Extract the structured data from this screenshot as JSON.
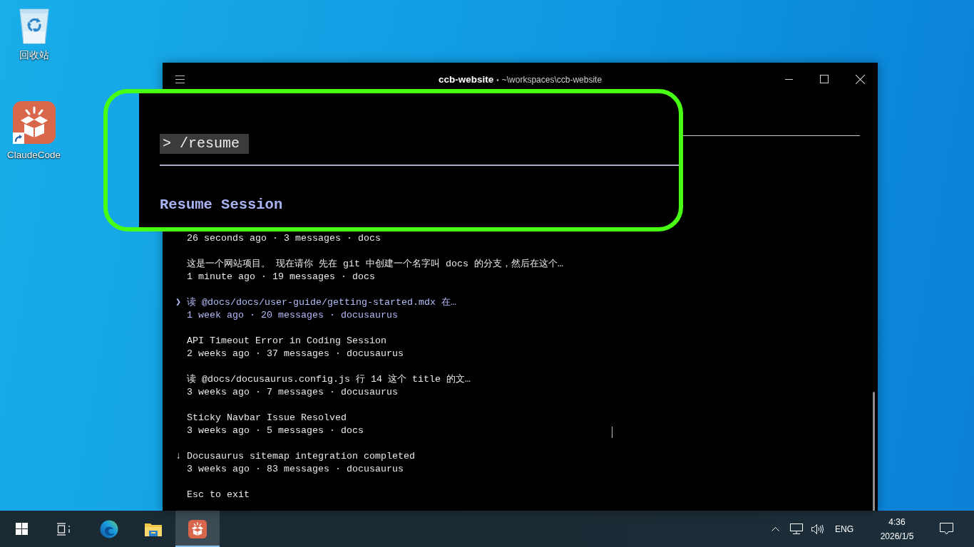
{
  "desktop_icons": [
    {
      "kind": "recycle-bin",
      "label": "回收站"
    },
    {
      "kind": "app-shortcut",
      "label": "ClaudeCode"
    }
  ],
  "window": {
    "title": "ccb-website",
    "separator": "•",
    "path": "~\\workspaces\\ccb-website"
  },
  "highlight": {
    "prompt": "> /resume",
    "heading": "Resume Session"
  },
  "sessions": [
    {
      "meta": "26 seconds ago · 3 messages · docs",
      "selected": false
    },
    {
      "title": "这是一个网站项目。 现在请你 先在 git 中创建一个名字叫 docs 的分支，然后在这个…",
      "meta": "1 minute ago · 19 messages · docs",
      "selected": false
    },
    {
      "marker": "❯",
      "title": "读 @docs/docs/user-guide/getting-started.mdx 在…",
      "meta": "1 week ago · 20 messages · docusaurus",
      "selected": true
    },
    {
      "title": "API Timeout Error in Coding Session",
      "meta": "2 weeks ago · 37 messages · docusaurus",
      "selected": false
    },
    {
      "title": "读 @docs/docusaurus.config.js 行 14 这个 title 的文…",
      "meta": "3 weeks ago · 7 messages · docusaurus",
      "selected": false
    },
    {
      "title": "Sticky Navbar Issue Resolved",
      "meta": "3 weeks ago · 5 messages · docs",
      "selected": false
    },
    {
      "marker": "↓",
      "title": "Docusaurus sitemap integration completed",
      "meta": "3 weeks ago · 83 messages · docusaurus",
      "selected": false
    }
  ],
  "footer_hint": "Esc to exit",
  "taskbar": {
    "apps": [
      {
        "kind": "browser",
        "selected": false
      },
      {
        "kind": "file-explorer",
        "selected": false
      },
      {
        "kind": "claude",
        "selected": true
      }
    ],
    "tray": {
      "language": "ENG",
      "time": "4:36",
      "date": "2026/1/5"
    }
  }
}
